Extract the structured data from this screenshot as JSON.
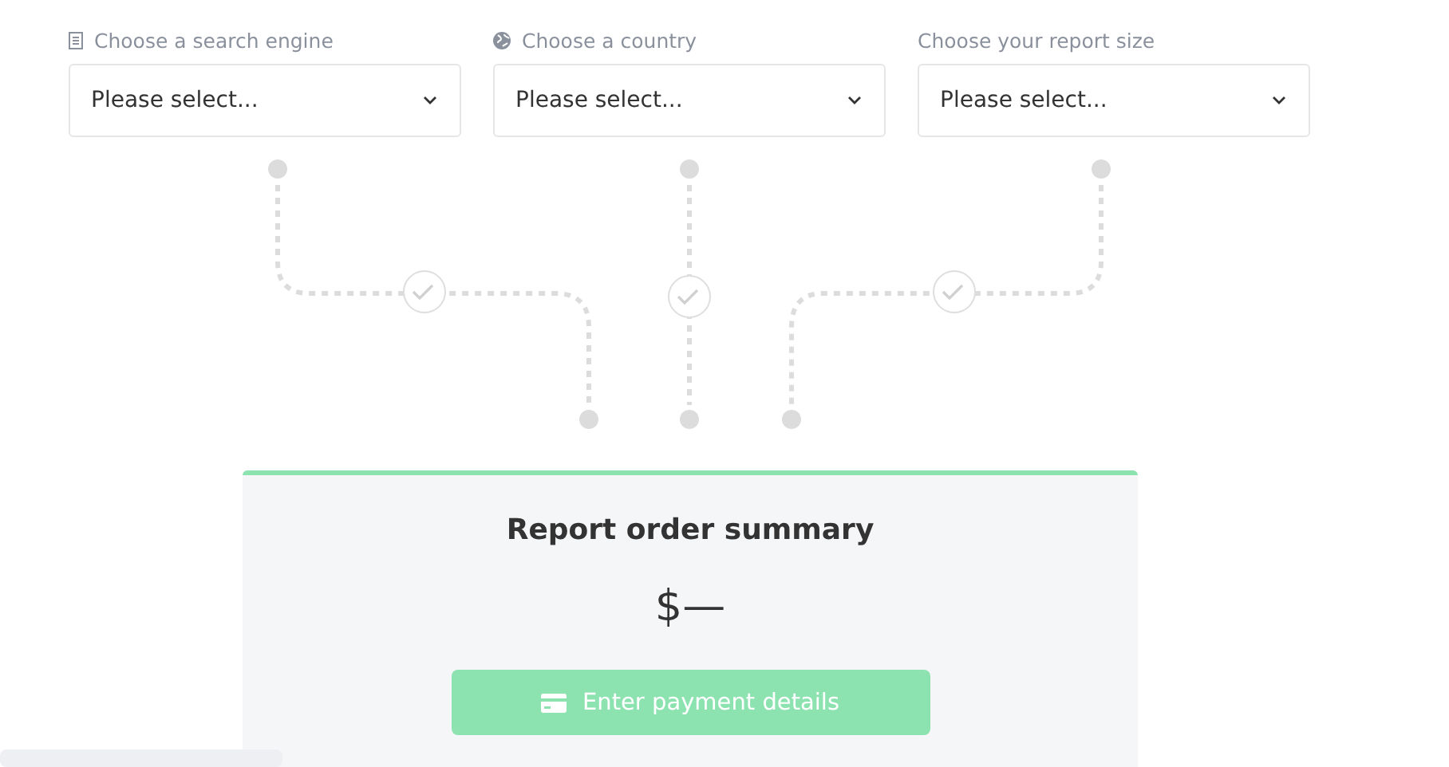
{
  "fields": [
    {
      "kind": "engine",
      "label": "Choose a search engine",
      "placeholder": "Please select..."
    },
    {
      "kind": "country",
      "label": "Choose a country",
      "placeholder": "Please select..."
    },
    {
      "kind": "size",
      "label": "Choose your report size",
      "placeholder": "Please select..."
    }
  ],
  "summary": {
    "title": "Report order summary",
    "price": "$—",
    "button": {
      "label": "Enter payment details",
      "disabled": true
    }
  }
}
